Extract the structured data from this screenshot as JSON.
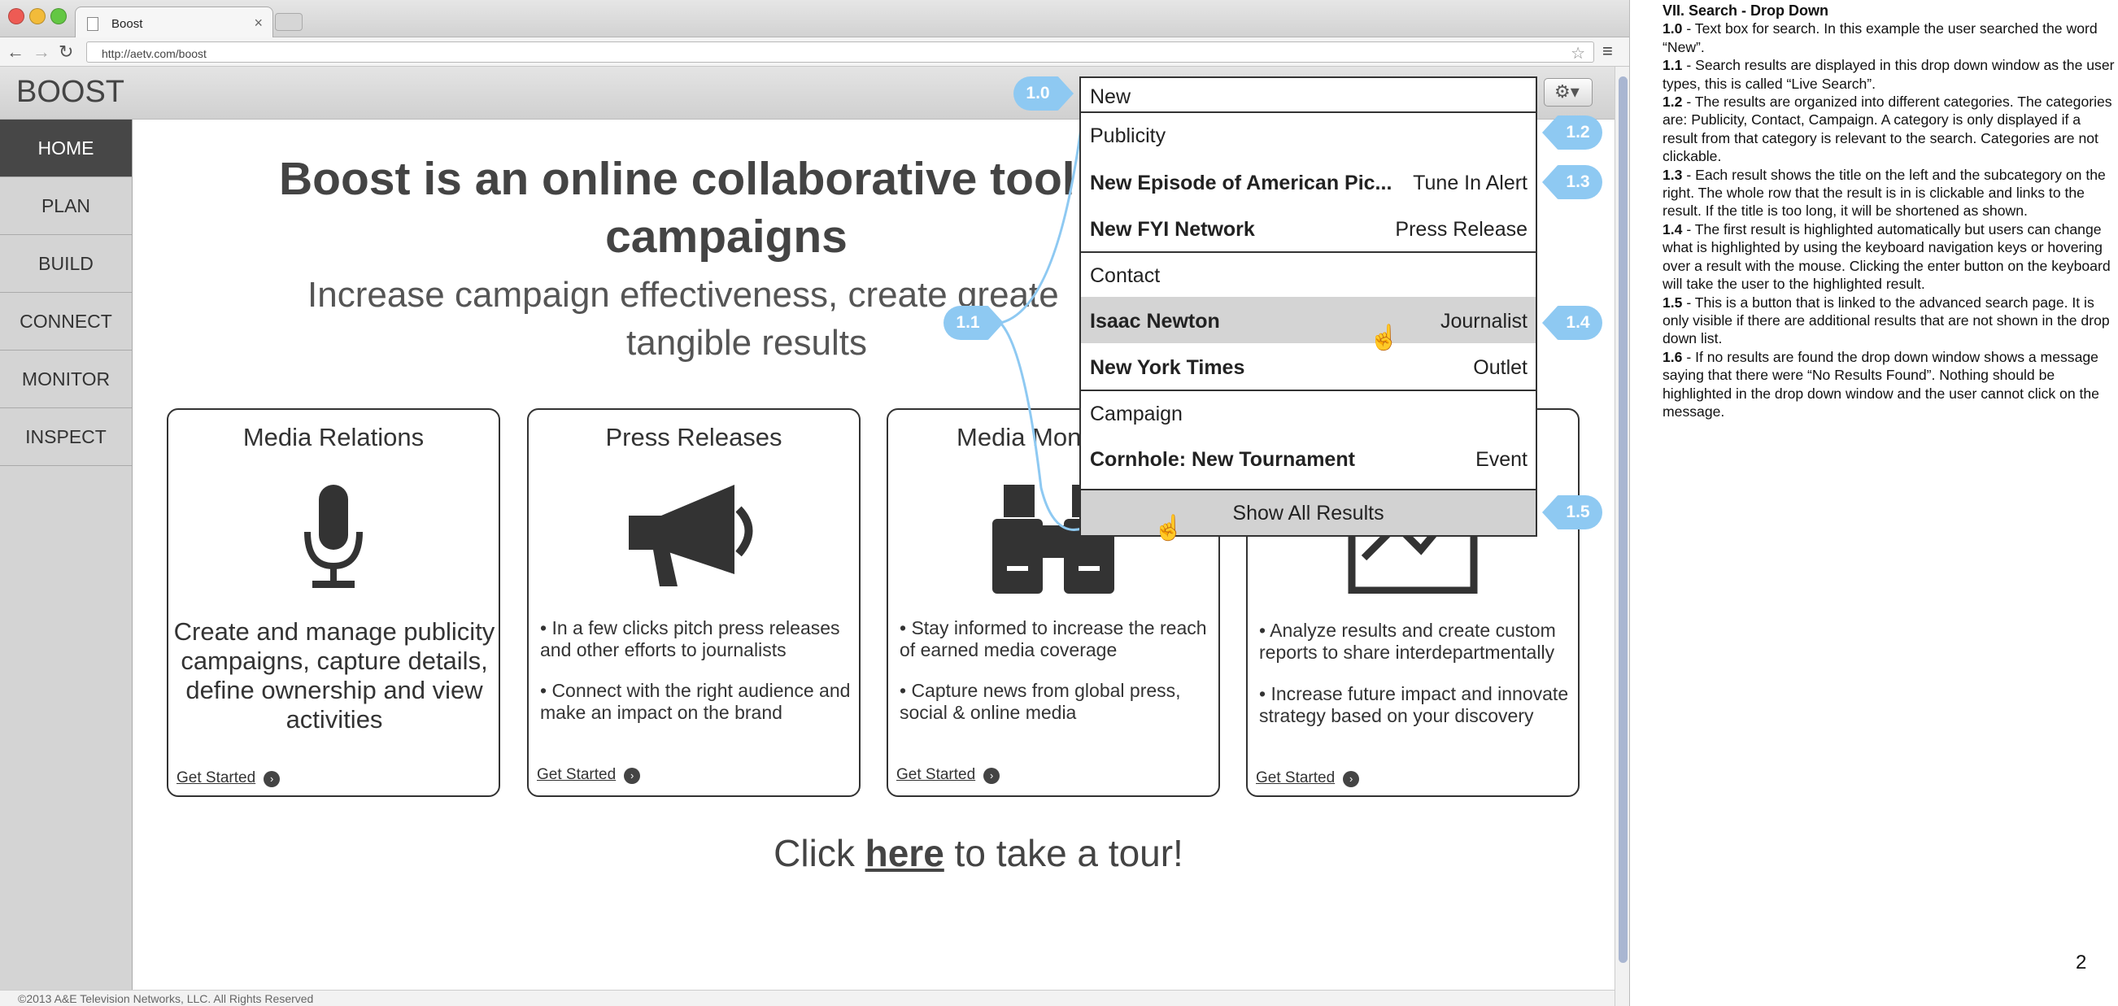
{
  "browser": {
    "tab_title": "Boost",
    "url": "http://aetv.com/boost"
  },
  "app": {
    "logo": "BOOST",
    "nav": [
      "HOME",
      "PLAN",
      "BUILD",
      "CONNECT",
      "MONITOR",
      "INSPECT"
    ],
    "active_nav": "HOME"
  },
  "hero": {
    "title_line1": "Boost is an online collaborative tool",
    "title_line2": "campaigns",
    "subtitle_line1": "Increase campaign effectiveness, create greate",
    "subtitle_line2": "tangible results"
  },
  "cards": [
    {
      "title": "Media Relations",
      "text": "Create and manage publicity campaigns, capture details, define ownership and view activities",
      "bullets": [],
      "link": "Get Started"
    },
    {
      "title": "Press Releases",
      "text": "",
      "bullets": [
        "• In a few clicks pitch press releases and other efforts to journalists",
        "• Connect with the right audience and make an impact on the brand"
      ],
      "link": "Get Started"
    },
    {
      "title": "Media Mon",
      "text": "",
      "bullets": [
        "• Stay informed to increase the reach of earned media coverage",
        "• Capture news from global press, social & online media"
      ],
      "link": "Get Started"
    },
    {
      "title": "",
      "text": "",
      "bullets": [
        "• Analyze results and create custom reports to share interdepartmentally",
        "• Increase future impact and innovate strategy based on your discovery"
      ],
      "link": "Get Started"
    }
  ],
  "tour": {
    "prefix": "Click ",
    "link": "here",
    "suffix": " to take a tour!"
  },
  "footer": "©2013 A&E Television Networks, LLC. All Rights Reserved",
  "search": {
    "query": "New",
    "categories": [
      {
        "name": "Publicity",
        "results": [
          {
            "title": "New Episode of American Pic...",
            "sub": "Tune In Alert"
          },
          {
            "title": "New FYI Network",
            "sub": "Press Release"
          }
        ]
      },
      {
        "name": "Contact",
        "results": [
          {
            "title": "Isaac Newton",
            "sub": "Journalist"
          },
          {
            "title": "New York Times",
            "sub": "Outlet"
          }
        ]
      },
      {
        "name": "Campaign",
        "results": [
          {
            "title": "Cornhole: New Tournament",
            "sub": "Event"
          }
        ]
      }
    ],
    "show_all": "Show All Results"
  },
  "callouts": [
    "1.0",
    "1.1",
    "1.2",
    "1.3",
    "1.4",
    "1.5"
  ],
  "notes": {
    "title": "VII. Search - Drop Down",
    "items": [
      {
        "num": "1.0",
        "text": " - Text box for search. In this example the user searched the word “New”."
      },
      {
        "num": "1.1",
        "text": " - Search results are displayed in this drop down window as the user types, this is called “Live Search”."
      },
      {
        "num": "1.2",
        "text": " - The results are organized into different categories. The categories are: Publicity, Contact, Campaign. A category is only displayed if a result from that category is relevant to the search. Categories are not clickable."
      },
      {
        "num": "1.3",
        "text": " - Each result shows the title on the left and the subcategory on the right. The whole row that the result is in is clickable and links to the result. If the title is too long, it will be shortened as shown."
      },
      {
        "num": "1.4",
        "text": " - The first result is highlighted automatically but users can change what is highlighted by using the keyboard navigation keys or hovering over a result with the mouse. Clicking the enter button on the keyboard will take the user to the highlighted result."
      },
      {
        "num": "1.5",
        "text": " - This is a button that is linked to the advanced search page. It is only visible if there are additional results that are not shown in the drop down list."
      },
      {
        "num": "1.6",
        "text": " - If no results are found the drop down window shows a message saying that there were “No Results Found”. Nothing should be highlighted in the drop down window and the user cannot click on the message."
      }
    ],
    "page_number": "2"
  },
  "colors": {
    "callout": "#8ec9f2",
    "active_nav": "#474747",
    "highlight": "#d4d4d4"
  },
  "icons": [
    "microphone-icon",
    "megaphone-icon",
    "binoculars-icon",
    "chart-icon",
    "gear-icon",
    "cursor-hand-icon"
  ]
}
